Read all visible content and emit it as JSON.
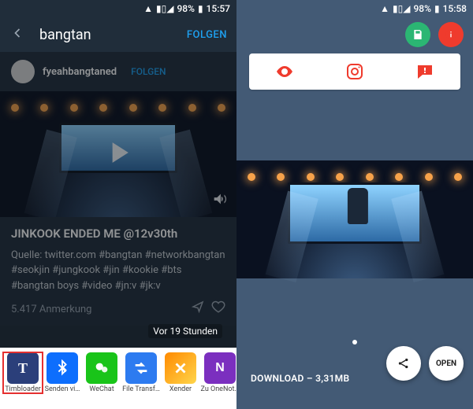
{
  "status": {
    "signal": "▮▮▮▮",
    "wifi": "📶",
    "battery_pct": "98%",
    "time_left": "15:57",
    "time_right": "15:58"
  },
  "left": {
    "title": "bangtan",
    "action_label": "FOLGEN",
    "post": {
      "username": "fyeahbangtaned",
      "follow_label": "FOLGEN",
      "title": "JINKOOK ENDED ME @12v30th",
      "source_line": "Quelle: twitter.com    #bangtan #networkbangtan   #seokjin   #jungkook   #jin #kookie   #bts   #bangtan boys   #video   #jn:v #jk:v",
      "notes": "5.417 Anmerkung",
      "timestamp": "Vor 19 Stunden"
    },
    "share_items": [
      {
        "label": "Timbloader"
      },
      {
        "label": "Senden vi…"
      },
      {
        "label": "WeChat"
      },
      {
        "label": "File Transf…"
      },
      {
        "label": "Xender"
      },
      {
        "label": "Zu OneNot…"
      }
    ]
  },
  "right": {
    "download_label": "DOWNLOAD – 3,31MB",
    "open_label": "OPEN"
  }
}
